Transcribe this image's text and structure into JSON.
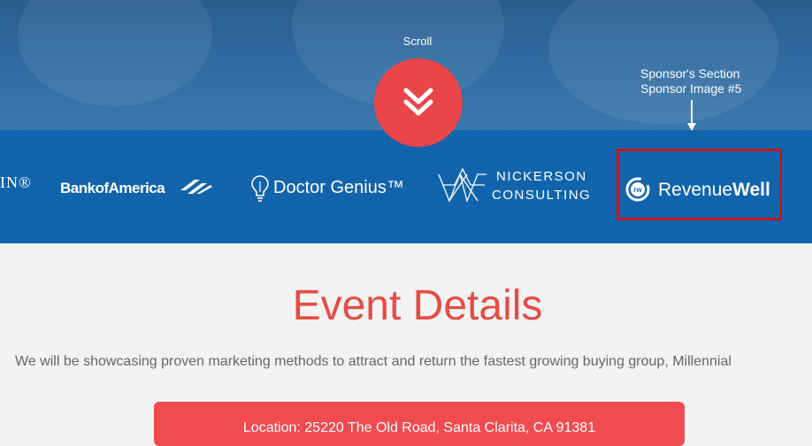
{
  "hero": {
    "scroll_label": "Scroll",
    "scroll_icon": "double-chevron-down-icon"
  },
  "annotation": {
    "line1": "Sponsor's Section",
    "line2": "Sponsor Image #5"
  },
  "sponsors": {
    "partial_logo_text": "IN®",
    "logos": [
      {
        "name": "Bank of America",
        "text": "BankofAmerica"
      },
      {
        "name": "Doctor Genius",
        "text": "Doctor Genius™"
      },
      {
        "name": "Nickerson Consulting",
        "line1": "NICKERSON",
        "line2": "CONSULTING"
      },
      {
        "name": "RevenueWell",
        "badge": "rw",
        "text_light": "Revenue",
        "text_bold": "Well"
      }
    ]
  },
  "event": {
    "title": "Event Details",
    "description": "We will be showcasing proven marketing methods to attract and return the fastest growing buying group, Millennial",
    "location": "Location: 25220 The Old Road, Santa Clarita, CA 91381"
  },
  "colors": {
    "hero_blue": "#2f6aa0",
    "sponsor_band": "#1164ac",
    "accent_red": "#ea4549",
    "highlight_border": "#c4161c"
  }
}
